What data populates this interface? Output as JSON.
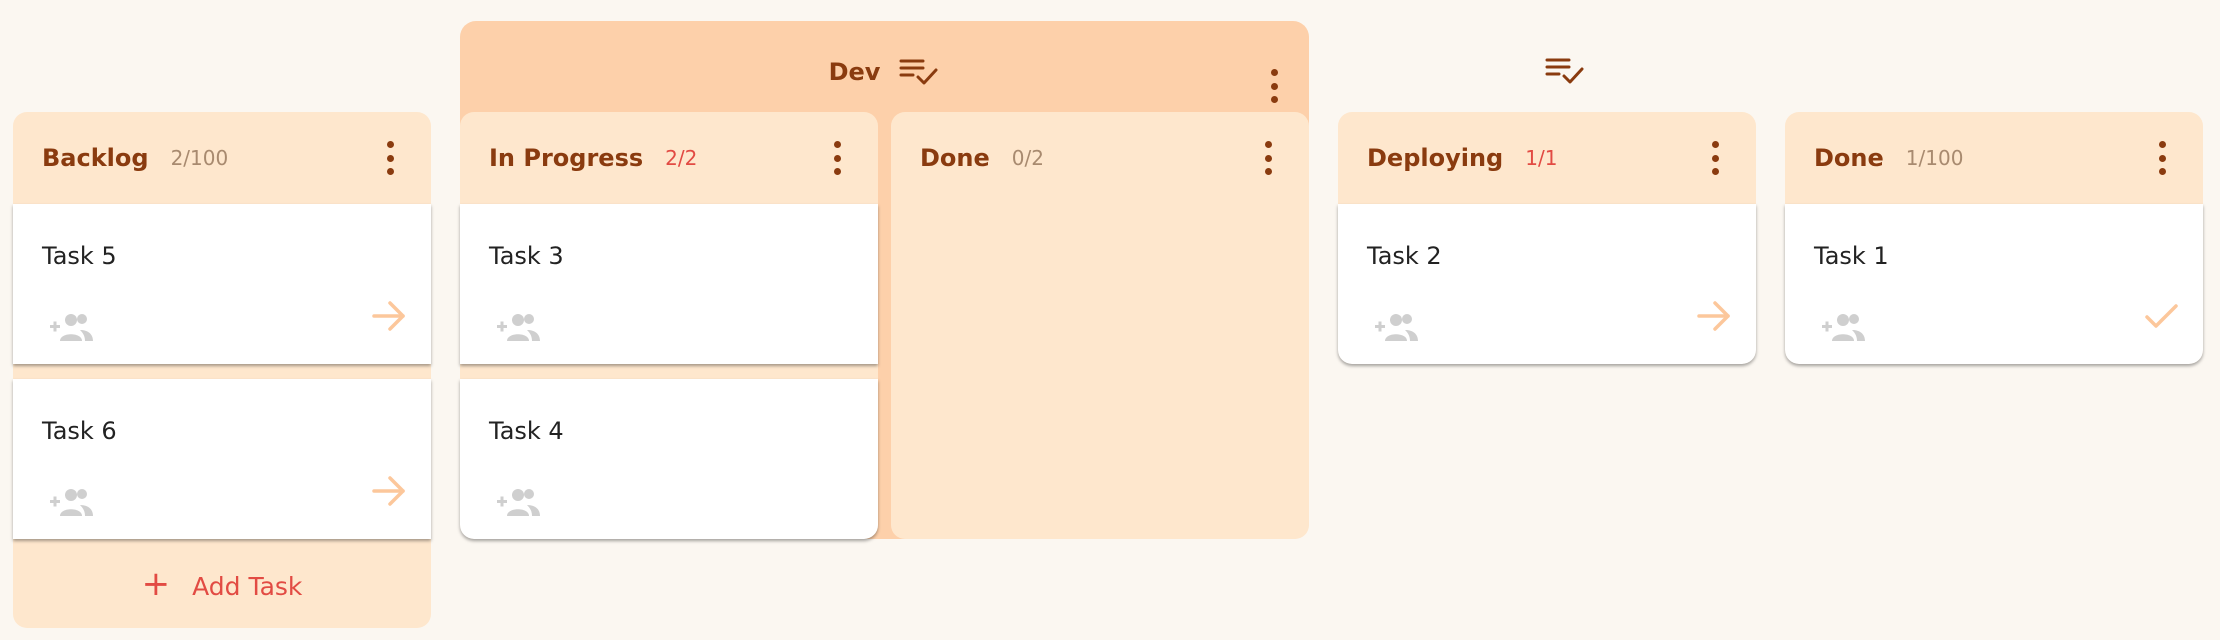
{
  "group": {
    "title": "Dev",
    "icon": "playlist-check-icon",
    "menu_icon": "more-vertical-icon"
  },
  "orphan_group_icon": "playlist-check-icon",
  "columns": [
    {
      "title": "Backlog",
      "count": "2/100",
      "cards": [
        {
          "name": "Task 5",
          "action": "arrow-right-icon"
        },
        {
          "name": "Task 6",
          "action": "arrow-right-icon"
        }
      ],
      "add_task_label": "Add Task"
    },
    {
      "title": "In Progress",
      "count": "2/2",
      "cards": [
        {
          "name": "Task 3"
        },
        {
          "name": "Task 4"
        }
      ]
    },
    {
      "title": "Done",
      "count": "0/2",
      "cards": []
    },
    {
      "title": "Deploying",
      "count": "1/1",
      "cards": [
        {
          "name": "Task 2",
          "action": "arrow-right-icon"
        }
      ]
    },
    {
      "title": "Done",
      "count": "1/100",
      "cards": [
        {
          "name": "Task 1",
          "action": "check-icon"
        }
      ]
    }
  ],
  "colors": {
    "background": "#fbf7f1",
    "group": "#fdd0aa",
    "column": "#fee7cd",
    "title": "#8a3b0f",
    "accent_red": "#e24b43",
    "arrow": "#fcc79b",
    "muted_icon": "#cfcfcf"
  }
}
